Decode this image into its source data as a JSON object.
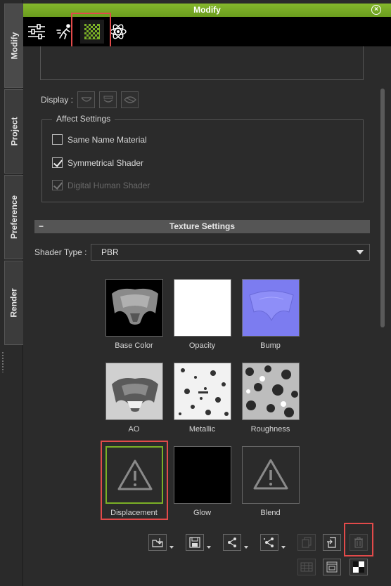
{
  "left_tabs": [
    {
      "label": "Modify"
    },
    {
      "label": "Project"
    },
    {
      "label": "Preference"
    },
    {
      "label": "Render"
    }
  ],
  "header": {
    "title": "Modify"
  },
  "toolbar": {
    "icons": [
      "sliders-icon",
      "motion-icon",
      "material-checker-icon",
      "physics-atom-icon"
    ],
    "active_index": 2
  },
  "display": {
    "label": "Display :"
  },
  "affect_settings": {
    "title": "Affect Settings",
    "options": [
      {
        "label": "Same Name Material",
        "checked": false,
        "enabled": true
      },
      {
        "label": "Symmetrical Shader",
        "checked": true,
        "enabled": true
      },
      {
        "label": "Digital Human Shader",
        "checked": true,
        "enabled": false
      }
    ]
  },
  "texture_settings": {
    "title": "Texture Settings",
    "collapse_symbol": "−",
    "shader_type_label": "Shader Type :",
    "shader_type_value": "PBR"
  },
  "textures": [
    {
      "label": "Base Color",
      "kind": "image-dark"
    },
    {
      "label": "Opacity",
      "kind": "white"
    },
    {
      "label": "Bump",
      "kind": "normal"
    },
    {
      "label": "AO",
      "kind": "image-gray"
    },
    {
      "label": "Metallic",
      "kind": "noise-light"
    },
    {
      "label": "Roughness",
      "kind": "noise-dark"
    },
    {
      "label": "Displacement",
      "kind": "warning",
      "selected": true
    },
    {
      "label": "Glow",
      "kind": "black"
    },
    {
      "label": "Blend",
      "kind": "warning"
    }
  ],
  "colors": {
    "accent": "#7bb026",
    "highlight": "#e24a4a",
    "panel": "#2b2b2b"
  }
}
